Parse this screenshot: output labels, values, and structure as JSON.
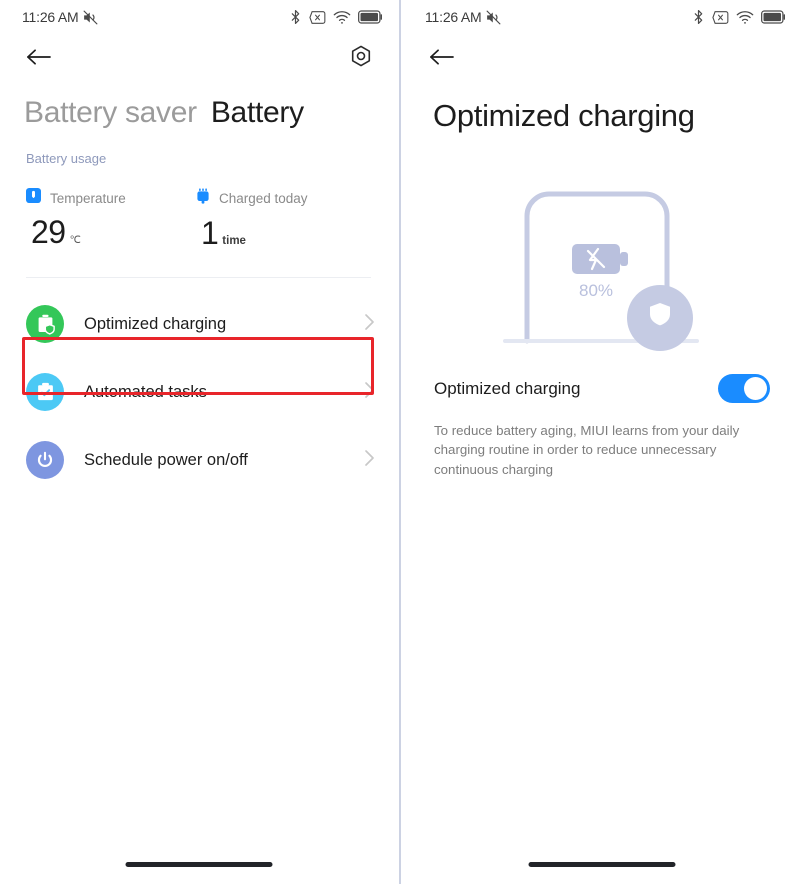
{
  "statusbar": {
    "time": "11:26 AM",
    "icons": [
      {
        "name": "mute-icon",
        "label": "Silent mode"
      },
      {
        "name": "bluetooth-icon",
        "label": "Bluetooth"
      },
      {
        "name": "no-sim-icon",
        "label": "No SIM"
      },
      {
        "name": "wifi-icon",
        "label": "Wi-Fi"
      },
      {
        "name": "battery-icon",
        "label": "Battery"
      }
    ]
  },
  "left": {
    "appbar": {
      "back_icon": "back-arrow-icon",
      "settings_icon": "gear-icon"
    },
    "tabs": [
      {
        "label": "Battery saver",
        "active": false
      },
      {
        "label": "Battery",
        "active": true
      }
    ],
    "battery_usage_link": "Battery usage",
    "stats": [
      {
        "icon": "thermometer-icon",
        "icon_color": "#1a8cff",
        "label": "Temperature",
        "value": "29",
        "unit": "℃"
      },
      {
        "icon": "charge-count-icon",
        "icon_color": "#1a8cff",
        "label": "Charged today",
        "value": "1",
        "unit": "time"
      }
    ],
    "list": [
      {
        "label": "Optimized charging",
        "icon": "battery-shield-icon",
        "icon_color": "#34c759",
        "chevron": "chevron-right-icon",
        "highlighted": true
      },
      {
        "label": "Automated tasks",
        "icon": "clipboard-check-icon",
        "icon_color": "#4cc9f5",
        "chevron": "chevron-right-icon",
        "highlighted": false
      },
      {
        "label": "Schedule power on/off",
        "icon": "power-icon",
        "icon_color": "#7e96e0",
        "chevron": "chevron-right-icon",
        "highlighted": false
      }
    ],
    "highlight_color": "#e8252a"
  },
  "right": {
    "appbar": {
      "back_icon": "back-arrow-icon"
    },
    "title": "Optimized charging",
    "illustration": {
      "name": "optimized-charging-illustration",
      "percent_label": "80%",
      "battery_icon": "battery-no-charge-icon",
      "shield_icon": "shield-icon",
      "color": "#c5cbe3"
    },
    "toggle": {
      "label": "Optimized charging",
      "state": "on",
      "accent": "#1a8cff"
    },
    "description": "To reduce battery aging, MIUI learns from your daily charging routine in order to reduce unnecessary continuous charging"
  },
  "homebar": {
    "name": "gesture-home-bar"
  }
}
